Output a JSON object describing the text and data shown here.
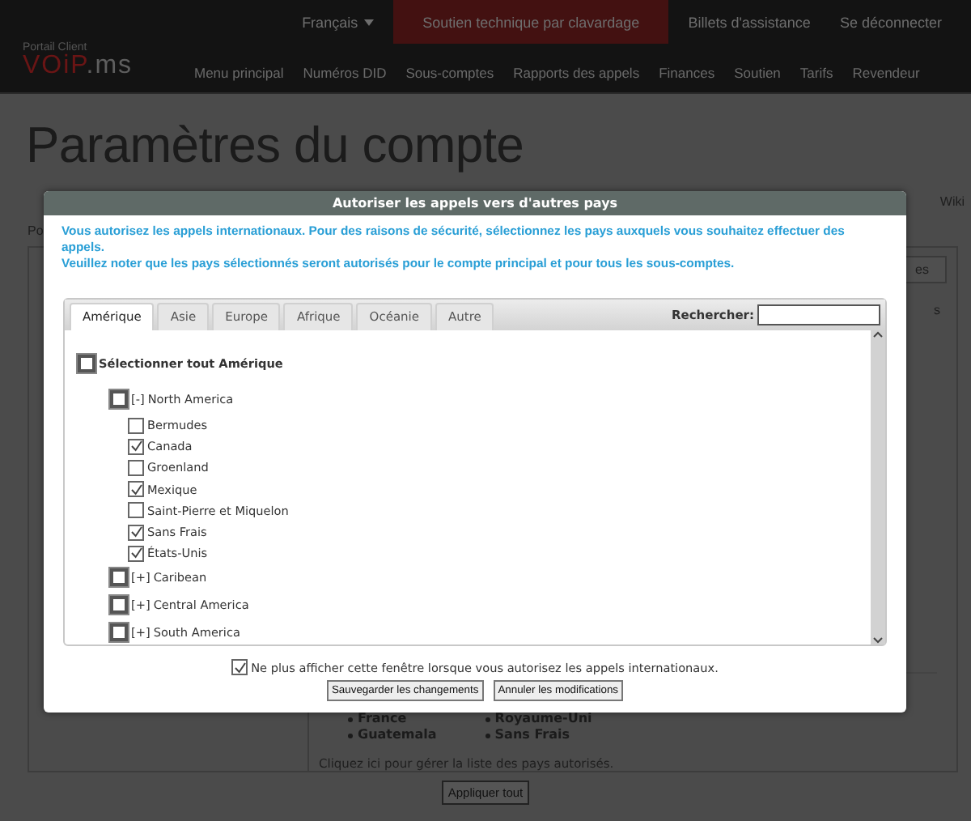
{
  "top_bar": {
    "language": "Français",
    "links": [
      {
        "label": "Soutien technique par clavardage",
        "highlighted": true
      },
      {
        "label": "Billets d'assistance",
        "highlighted": false
      },
      {
        "label": "Se déconnecter",
        "highlighted": false
      }
    ]
  },
  "brand": {
    "caption": "Portail Client",
    "logo_primary": "VOiP",
    "logo_secondary": ".ms"
  },
  "nav": [
    "Menu principal",
    "Numéros DID",
    "Sous-comptes",
    "Rapports des appels",
    "Finances",
    "Soutien",
    "Tarifs",
    "Revendeur"
  ],
  "page": {
    "title": "Paramètres du compte",
    "left_fragment": "Po",
    "right_link": "Wiki",
    "right_button": "es",
    "right_fragment": "s",
    "country_columns": [
      [
        "France",
        "Guatemala"
      ],
      [
        "Royaume-Uni",
        "Sans Frais"
      ]
    ],
    "manage_link": "Cliquez ici pour gérer la liste des pays autorisés.",
    "apply_button": "Appliquer tout"
  },
  "dialog": {
    "title": "Autoriser les appels vers d'autres pays",
    "intro": [
      "Vous autorisez les appels internationaux. Pour des raisons de sécurité, sélectionnez les pays auxquels vous souhaitez effectuer des appels.",
      "Veuillez noter que les pays sélectionnés seront autorisés pour le compte principal et pour tous les sous-comptes."
    ],
    "tabs": [
      {
        "label": "Amérique",
        "selected": true
      },
      {
        "label": "Asie",
        "selected": false
      },
      {
        "label": "Europe",
        "selected": false
      },
      {
        "label": "Afrique",
        "selected": false
      },
      {
        "label": "Océanie",
        "selected": false
      },
      {
        "label": "Autre",
        "selected": false
      }
    ],
    "search_label": "Rechercher:",
    "select_all": {
      "label": "Sélectionner tout Amérique",
      "checked": false
    },
    "regions": [
      {
        "toggle": "[-]",
        "label": "North America",
        "checked": false,
        "children": [
          {
            "label": "Bermudes",
            "checked": false
          },
          {
            "label": "Canada",
            "checked": true
          },
          {
            "label": "Groenland",
            "checked": false
          },
          {
            "label": "Mexique",
            "checked": true
          },
          {
            "label": "Saint-Pierre et Miquelon",
            "checked": false
          },
          {
            "label": "Sans Frais",
            "checked": true
          },
          {
            "label": "États-Unis",
            "checked": true
          }
        ]
      },
      {
        "toggle": "[+]",
        "label": "Caribean",
        "checked": false
      },
      {
        "toggle": "[+]",
        "label": "Central America",
        "checked": false
      },
      {
        "toggle": "[+]",
        "label": "South America",
        "checked": false
      }
    ],
    "dont_show": {
      "label": "Ne plus afficher cette fenêtre lorsque vous autorisez les appels internationaux.",
      "checked": true
    },
    "buttons": [
      "Sauvegarder les changements",
      "Annuler les modifications"
    ]
  }
}
